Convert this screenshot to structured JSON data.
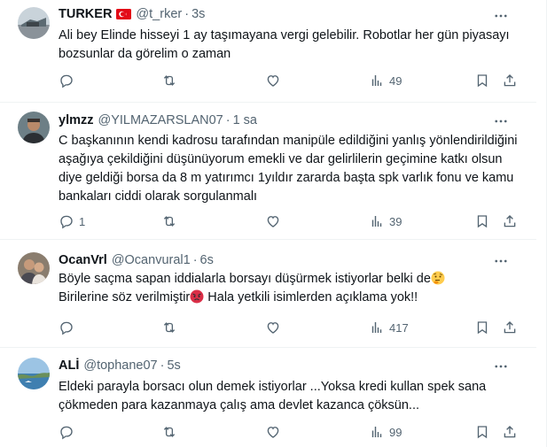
{
  "tweets": [
    {
      "name": "TURKER",
      "handle": "@t_rker",
      "time": "3s",
      "has_flag": true,
      "text": "Ali bey Elinde hisseyi 1 ay taşımayana vergi gelebilir. Robotlar her gün piyasayı bozsunlar da görelim o zaman",
      "replies": "",
      "reposts": "",
      "likes": "",
      "views": "49"
    },
    {
      "name": "ylmzz",
      "handle": "@YILMAZARSLAN07",
      "time": "1 sa",
      "text": "C başkanının kendi kadrosu tarafından manipüle edildiğini yanlış yönlendirildiğini aşağıya çekildiğini düşünüyorum emekli ve dar gelirlilerin geçimine katkı olsun diye geldiği borsa da 8 m yatırımcı 1yıldır zararda başta spk varlık fonu ve kamu bankaları ciddi olarak sorgulanmalı",
      "replies": "1",
      "reposts": "",
      "likes": "",
      "views": "39"
    },
    {
      "name": "OcanVrl",
      "handle": "@Ocanvural1",
      "time": "6s",
      "text_line1": "Böyle saçma sapan iddialarla borsayı düşürmek istiyorlar belki de",
      "text_line2a": "Birilerine söz verilmiştir",
      "text_line2b": " Hala yetkili isimlerden açıklama yok!!",
      "emoji1": "thinking-face",
      "emoji2": "angry-face",
      "replies": "",
      "reposts": "",
      "likes": "",
      "views": "417"
    },
    {
      "name": "ALİ",
      "handle": "@tophane07",
      "time": "5s",
      "text": "Eldeki parayla borsacı olun demek istiyorlar ...Yoksa kredi kullan spek sana çökmeden para kazanmaya çalış ama devlet kazanca çöksün...",
      "replies": "",
      "reposts": "",
      "likes": "",
      "views": "99"
    }
  ],
  "icons": [
    "reply-icon",
    "repost-icon",
    "like-icon",
    "views-icon",
    "bookmark-icon",
    "share-icon",
    "more-icon"
  ],
  "colors": {
    "text": "#0f1419",
    "secondary": "#536471",
    "divider": "#eff3f4",
    "flag_red": "#e30a17"
  }
}
